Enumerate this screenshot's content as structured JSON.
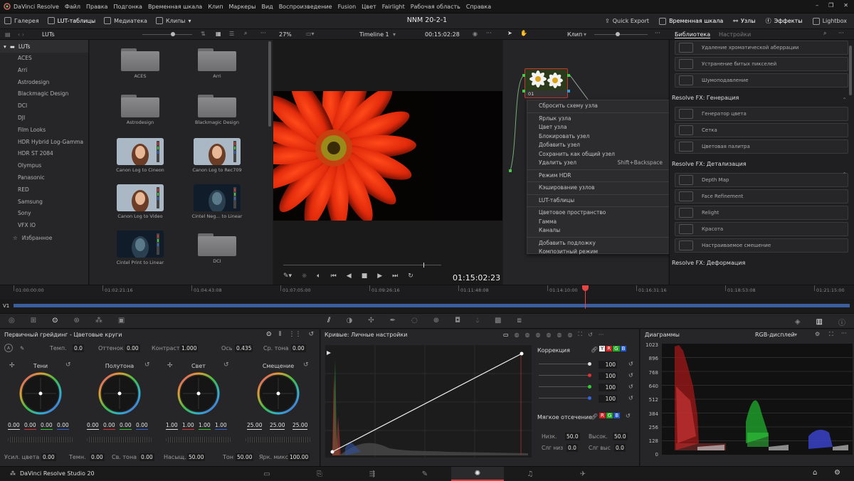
{
  "menubar": {
    "app_name": "DaVinci Resolve",
    "items": [
      "Файл",
      "Правка",
      "Подгонка",
      "Временная шкала",
      "Клип",
      "Маркеры",
      "Вид",
      "Воспроизведение",
      "Fusion",
      "Цвет",
      "Fairlight",
      "Рабочая область",
      "Справка"
    ]
  },
  "toolbar": {
    "gallery": "Галерея",
    "lut_tables": "LUT-таблицы",
    "media": "Медиатека",
    "clips": "Клипы",
    "project_title": "NNM 20-2-1",
    "quick_export": "Quick Export",
    "timeline": "Временная шкала",
    "nodes": "Узлы",
    "effects": "Эффекты",
    "lightbox": "Lightbox"
  },
  "subbar": {
    "luts_title": "LUTs",
    "zoom": "27%",
    "timeline_name": "Timeline 1",
    "timecode": "00:15:02:28",
    "clip_mode": "Клип",
    "library_tab": "Библиотека",
    "settings_tab": "Настройки"
  },
  "lut_tree": {
    "root": "LUTs",
    "items": [
      "ACES",
      "Arri",
      "Astrodesign",
      "Blackmagic Design",
      "DCI",
      "DJI",
      "Film Looks",
      "HDR Hybrid Log-Gamma",
      "HDR ST 2084",
      "Olympus",
      "Panasonic",
      "RED",
      "Samsung",
      "Sony",
      "VFX IO"
    ],
    "favorites": "Избранное"
  },
  "lut_grid": [
    {
      "label": "ACES",
      "kind": "folder"
    },
    {
      "label": "Arri",
      "kind": "folder"
    },
    {
      "label": "Astrodesign",
      "kind": "folder"
    },
    {
      "label": "Blackmagic Design",
      "kind": "folder"
    },
    {
      "label": "Canon Log to Cineon",
      "kind": "thumb"
    },
    {
      "label": "Canon Log to Rec709",
      "kind": "thumb"
    },
    {
      "label": "Canon Log to Video",
      "kind": "thumb"
    },
    {
      "label": "Cintel Neg... to Linear",
      "kind": "thumb-dark"
    },
    {
      "label": "Cintel Print to Linear",
      "kind": "thumb-dark"
    },
    {
      "label": "DCI",
      "kind": "folder"
    }
  ],
  "viewer": {
    "timecode": "01:15:02:23"
  },
  "node": {
    "label": "01"
  },
  "context_menu": {
    "items": [
      {
        "label": "Сбросить схему узла",
        "submenu": false
      },
      {
        "sep": true
      },
      {
        "label": "Ярлык узла",
        "submenu": false
      },
      {
        "label": "Цвет узла",
        "submenu": true
      },
      {
        "label": "Блокировать узел",
        "submenu": false
      },
      {
        "label": "Добавить узел",
        "submenu": true
      },
      {
        "label": "Сохранить как общий узел",
        "submenu": false
      },
      {
        "label": "Удалить узел",
        "submenu": false,
        "shortcut": "Shift+Backspace"
      },
      {
        "sep": true
      },
      {
        "label": "Режим HDR",
        "submenu": false
      },
      {
        "sep": true
      },
      {
        "label": "Кэширование узлов",
        "submenu": true
      },
      {
        "sep": true
      },
      {
        "label": "LUT-таблицы",
        "submenu": true
      },
      {
        "sep": true
      },
      {
        "label": "Цветовое пространство",
        "submenu": true
      },
      {
        "label": "Гамма",
        "submenu": true
      },
      {
        "label": "Каналы",
        "submenu": true
      },
      {
        "sep": true
      },
      {
        "label": "Добавить подложку",
        "submenu": true
      },
      {
        "label": "Композитный режим",
        "submenu": true
      }
    ]
  },
  "library": {
    "top_items": [
      "Удаление хроматической аберрации",
      "Устранение битых пикселей",
      "Шумоподавление"
    ],
    "section_generation": "Resolve FX: Генерация",
    "generation_items": [
      "Генератор цвета",
      "Сетка",
      "Цветовая палитра"
    ],
    "section_detail": "Resolve FX: Детализация",
    "detail_items": [
      "Depth Map",
      "Face Refinement",
      "Relight",
      "Красота",
      "Настраиваемое смешение"
    ],
    "section_deform": "Resolve FX: Деформация"
  },
  "ruler": {
    "ticks": [
      "01:00:00:00",
      "01:02:21:16",
      "01:04:43:08",
      "01:07:05:00",
      "01:09:26:16",
      "01:11:48:08",
      "01:14:10:00",
      "01:16:31:16",
      "01:18:53:08",
      "01:21:15:00"
    ],
    "track": "V1",
    "playhead_fraction": 0.683
  },
  "primaries": {
    "title": "Первичный грейдинг - Цветовые круги",
    "temp_label": "Темп.",
    "temp": "0.0",
    "tint_label": "Оттенок",
    "tint": "0.00",
    "contrast_label": "Контраст",
    "contrast": "1.000",
    "pivot_label": "Ось",
    "pivot": "0.435",
    "midtone_label": "Ср. тона",
    "midtone": "0.00",
    "wheels": [
      {
        "name": "Тени",
        "values": [
          "0.00",
          "0.00",
          "0.00",
          "0.00"
        ]
      },
      {
        "name": "Полутона",
        "values": [
          "0.00",
          "0.00",
          "0.00",
          "0.00"
        ]
      },
      {
        "name": "Свет",
        "values": [
          "1.00",
          "1.00",
          "1.00",
          "1.00"
        ]
      },
      {
        "name": "Смещение",
        "values": [
          "25.00",
          "25.00",
          "25.00"
        ]
      }
    ],
    "boost_label": "Усил. цвета",
    "boost": "0.00",
    "shadows_label": "Темн.",
    "shadows": "0.00",
    "hl_label": "Св. тона",
    "hl": "0.00",
    "sat_label": "Насыщ.",
    "sat": "50.00",
    "hue_label": "Тон",
    "hue": "50.00",
    "lummix_label": "Ярк. микс",
    "lummix": "100.00"
  },
  "curves": {
    "title": "Кривые: Личные настройки",
    "correction_label": "Коррекция",
    "channel_values": [
      "100",
      "100",
      "100",
      "100"
    ],
    "soft_clip_label": "Мягкое отсечение",
    "low_label": "Низк.",
    "low": "50.0",
    "high_label": "Высок.",
    "high": "50.0",
    "low_soft_label": "Слг низ",
    "low_soft": "0.0",
    "high_soft_label": "Слг выс",
    "high_soft": "0.0"
  },
  "scopes": {
    "title": "Диаграммы",
    "mode": "RGB-дисплей",
    "scale": [
      "1023",
      "896",
      "768",
      "640",
      "512",
      "384",
      "256",
      "128",
      "0"
    ]
  },
  "statusbar": {
    "app": "DaVinci Resolve Studio 20"
  },
  "colors": {
    "accent_red": "#e03a3a",
    "timeline_blue": "#3b5f9e",
    "playhead": "#e64545"
  }
}
